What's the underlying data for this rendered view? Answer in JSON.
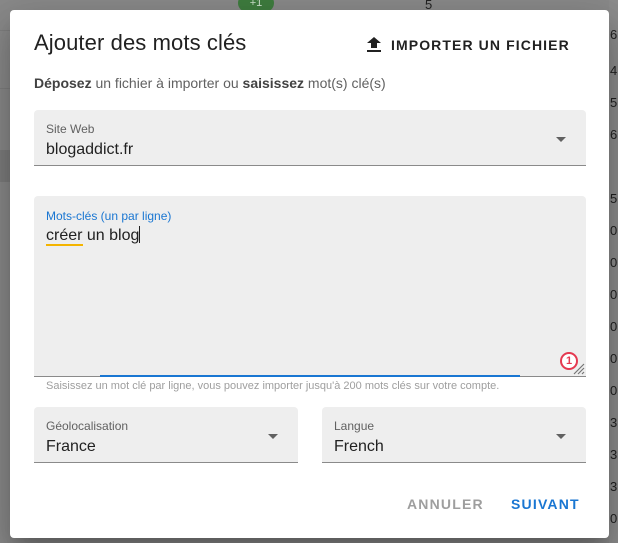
{
  "background": {
    "badge": "+1",
    "numbers": [
      "5",
      "6",
      "4",
      "5",
      "6",
      "5",
      "0",
      "0",
      "0",
      "0",
      "0",
      "0",
      "3",
      "3",
      "3",
      "0",
      "0"
    ]
  },
  "dialog": {
    "title": "Ajouter des mots clés",
    "import_button": {
      "label": "IMPORTER UN FICHIER",
      "icon": "upload-icon"
    },
    "subtitle": {
      "part1": "Déposez",
      "part2": " un fichier à importer ou ",
      "part3": "saisissez",
      "part4": " mot(s) clé(s)"
    },
    "website_field": {
      "label": "Site Web",
      "value": "blogaddict.fr"
    },
    "keywords_field": {
      "label": "Mots-clés (un par ligne)",
      "value": "créer un blog",
      "error_count": "1",
      "helper": "Saisissez un mot clé par ligne, vous pouvez importer jusqu'à 200 mots clés sur votre compte."
    },
    "geolocation_field": {
      "label": "Géolocalisation",
      "value": "France"
    },
    "language_field": {
      "label": "Langue",
      "value": "French"
    },
    "cancel_label": "ANNULER",
    "next_label": "SUIVANT"
  },
  "colors": {
    "primary": "#1976d2",
    "error": "#e53950",
    "spellcheck": "#f4b400"
  }
}
